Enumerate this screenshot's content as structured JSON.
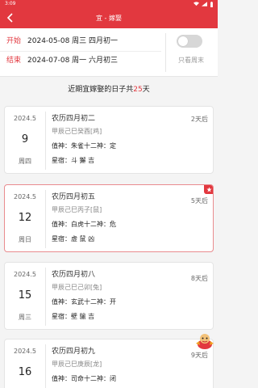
{
  "status_bar": {
    "time": "3:09"
  },
  "navbar": {
    "title": "宜 - 嫁娶"
  },
  "range": {
    "start_label": "开始",
    "start_value": "2024-05-08 周三 四月初一",
    "end_label": "结束",
    "end_value": "2024-07-08 周一 六月初三",
    "weekend_toggle_label": "只看周末",
    "weekend_only": false
  },
  "summary": {
    "prefix": "近期宜嫁娶的日子共",
    "count": "25",
    "suffix": "天"
  },
  "cards": [
    {
      "ym": "2024.5",
      "day": "9",
      "weekday": "周四",
      "lunar": "农历四月初二",
      "ganzhi": "甲辰己巳癸酉[鸡]",
      "zhishen": "值神：朱雀十二神：定",
      "xingxiu": "星宿：斗 獬 吉",
      "after": "2天后",
      "weekend": false
    },
    {
      "ym": "2024.5",
      "day": "12",
      "weekday": "周日",
      "lunar": "农历四月初五",
      "ganzhi": "甲辰己巳丙子[鼠]",
      "zhishen": "值神：白虎十二神：危",
      "xingxiu": "星宿：虚 鼠 凶",
      "after": "5天后",
      "weekend": true
    },
    {
      "ym": "2024.5",
      "day": "15",
      "weekday": "周三",
      "lunar": "农历四月初八",
      "ganzhi": "甲辰己巳己卯[兔]",
      "zhishen": "值神：玄武十二神：开",
      "xingxiu": "星宿：壁 貐 吉",
      "after": "8天后",
      "weekend": false
    },
    {
      "ym": "2024.5",
      "day": "16",
      "weekday": "",
      "lunar": "农历四月初九",
      "ganzhi": "甲辰己巳庚辰[龙]",
      "zhishen": "值神：司命十二神：闭",
      "xingxiu": "",
      "after": "9天后",
      "weekend": false
    }
  ]
}
